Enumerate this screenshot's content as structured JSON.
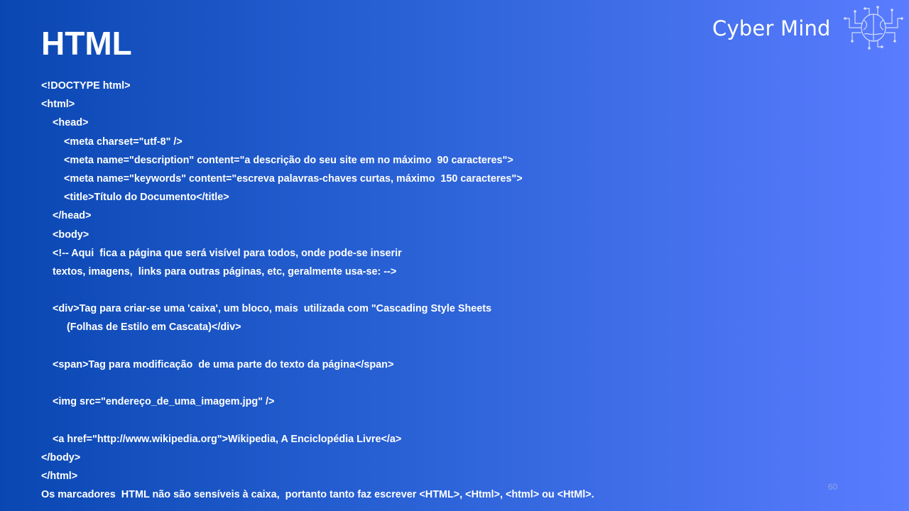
{
  "slide": {
    "title": "HTML",
    "page_number": "60"
  },
  "logo": {
    "text": "Cyber Mind",
    "icon": "brain-circuit-icon"
  },
  "code_lines": [
    "<!DOCTYPE html>",
    "<html>",
    "<head>",
    "<meta charset=\"utf-8\" />",
    "<meta name=\"description\" content=\"a descrição do seu site em no máximo  90 caracteres\">",
    "<meta name=\"keywords\" content=\"escreva palavras-chaves curtas, máximo  150 caracteres\">",
    "<title>Título do Documento</title>",
    "</head>",
    "<body>",
    "<!-- Aqui  fica a página que será visível para todos, onde pode-se inserir",
    "textos, imagens,  links para outras páginas, etc, geralmente usa-se: -->",
    "",
    "<div>Tag para criar-se uma 'caixa', um bloco, mais  utilizada com \"Cascading Style Sheets",
    "(Folhas de Estilo em Cascata)</div>",
    "",
    "<span>Tag para modificação  de uma parte do texto da página</span>",
    "",
    "<img src=\"endereço_de_uma_imagem.jpg\" />",
    "",
    "<a href=\"http://www.wikipedia.org\">Wikipedia, A Enciclopédia Livre</a>",
    "</body>",
    "</html>",
    "Os marcadores  HTML não são sensíveis à caixa,  portanto tanto faz escrever <HTML>, <Html>, <html> ou <HtMl>."
  ]
}
